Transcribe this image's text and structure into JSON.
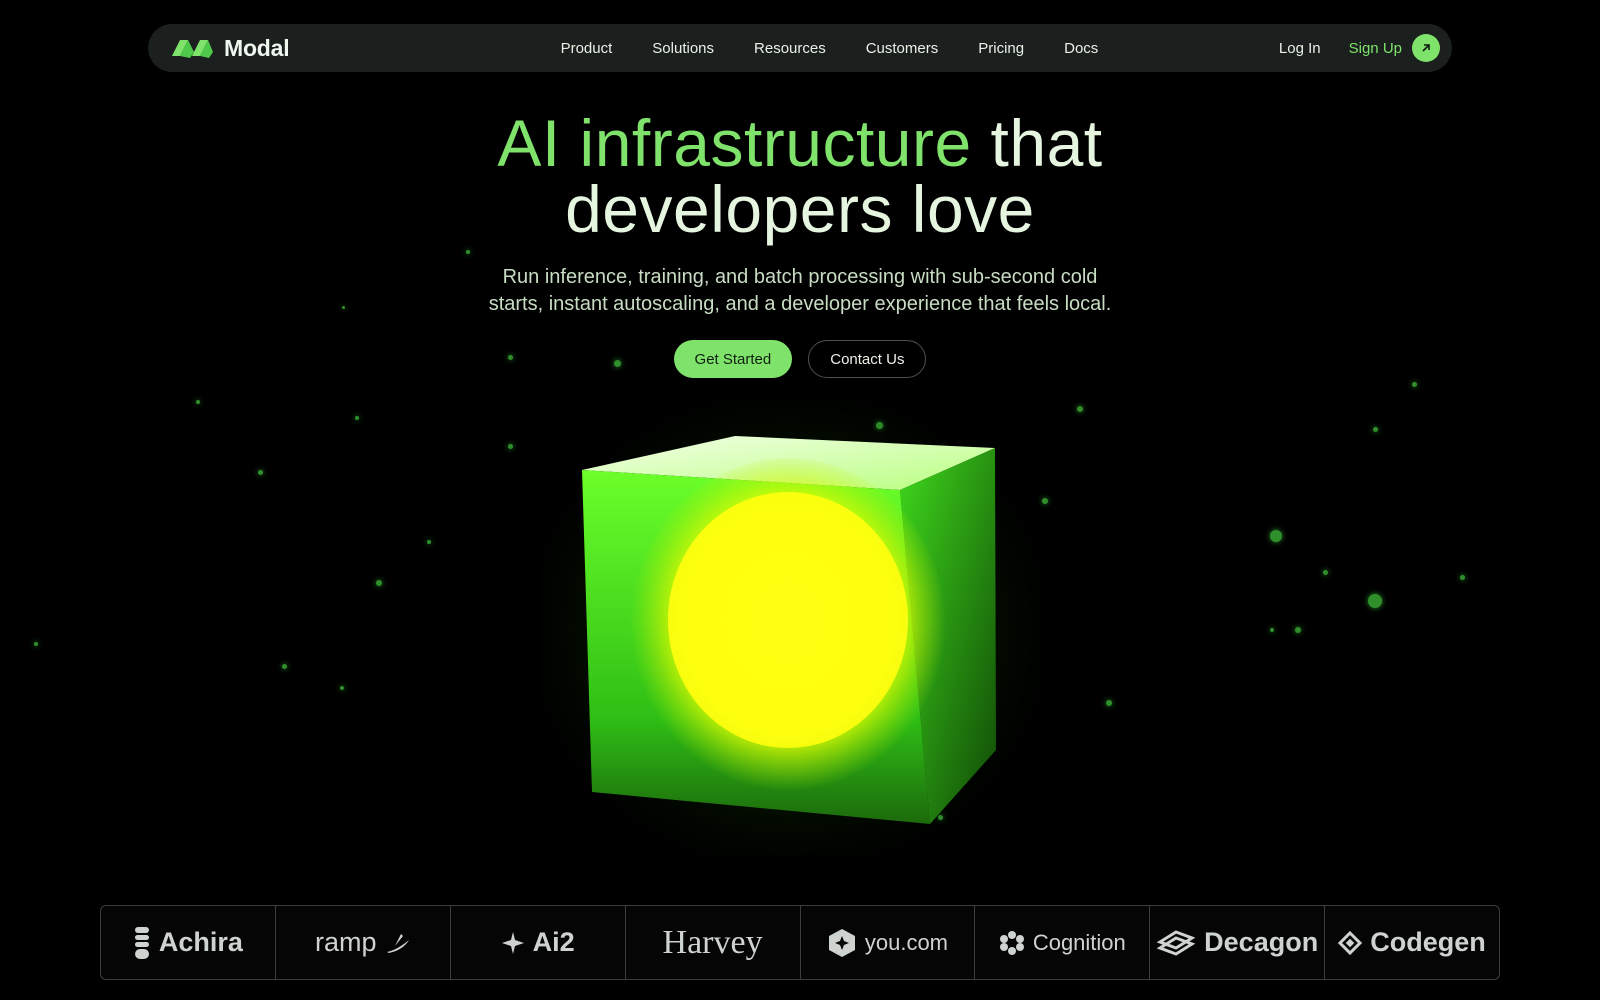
{
  "nav": {
    "brand": "Modal",
    "links": [
      "Product",
      "Solutions",
      "Resources",
      "Customers",
      "Pricing",
      "Docs"
    ],
    "login": "Log In",
    "signup": "Sign Up"
  },
  "hero": {
    "headline_accent": "AI infrastructure",
    "headline_rest_line1": "that",
    "headline_line2": "developers love",
    "subhead_line1": "Run inference, training, and batch processing with sub-second cold",
    "subhead_line2": "starts, instant autoscaling, and a developer experience that feels local.",
    "cta_primary": "Get Started",
    "cta_secondary": "Contact Us"
  },
  "customers": [
    "Achira",
    "ramp",
    "Ai2",
    "Harvey",
    "you.com",
    "Cognition",
    "Decagon",
    "Codegen"
  ],
  "colors": {
    "accent": "#7fe36b",
    "background": "#000000",
    "nav_bg": "#1b1f1d",
    "cube_glow": "#e8ff00"
  }
}
